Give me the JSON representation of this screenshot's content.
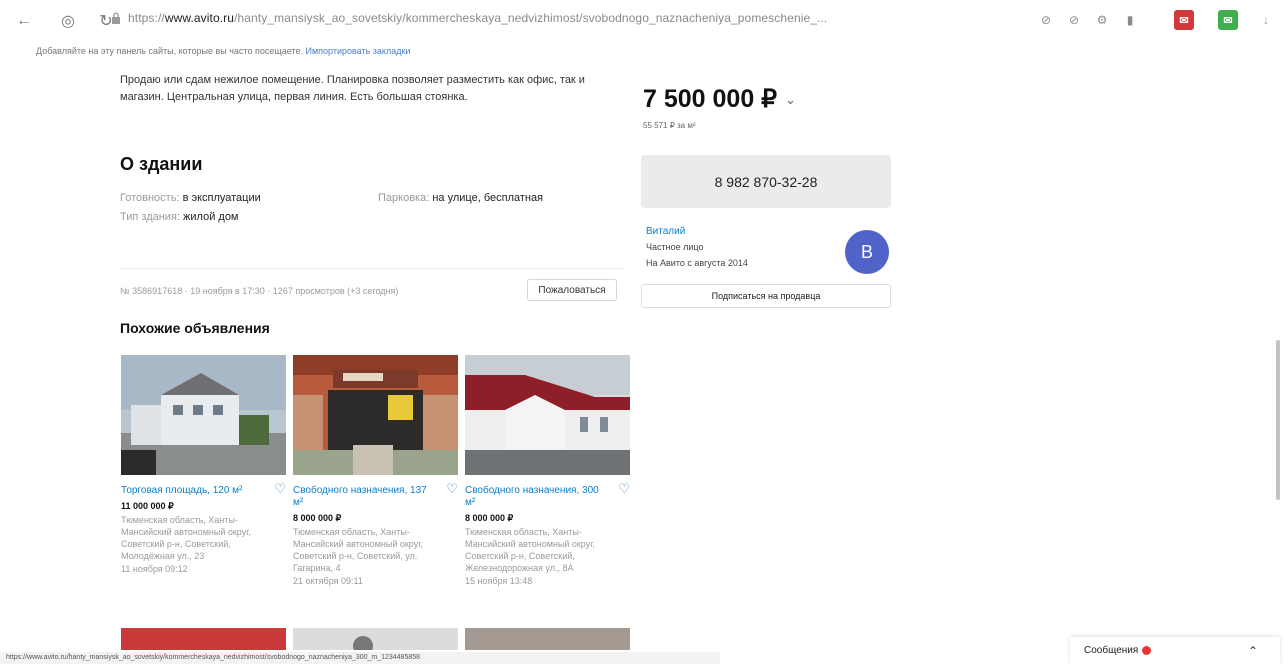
{
  "browser": {
    "url_prefix": "https://",
    "url_domain": "www.avito.ru",
    "url_rest": "/hanty_mansiysk_ao_sovetskiy/kommercheskaya_nedvizhimost/svobodnogo_naznacheniya_pomeschenie_...",
    "bookmarks_hint": "Добавляйте на эту панель сайты, которые вы часто посещаете.",
    "bookmarks_import": "Импортировать закладки"
  },
  "listing": {
    "description": "Продаю или сдам нежилое помещение. Планировка позволяет разместить как офис, так и магазин. Центральная улица, первая линия. Есть большая стоянка.",
    "building_heading": "О здании",
    "props": [
      {
        "key": "Готовность:",
        "value": "в эксплуатации"
      },
      {
        "key": "Тип здания:",
        "value": "жилой дом"
      },
      {
        "key": "Парковка:",
        "value": "на улице, бесплатная"
      }
    ],
    "meta": "№ 3586917618 · 19 ноября в 17:30 · 1267 просмотров (+3 сегодня)",
    "complain_label": "Пожаловаться",
    "price": "7 500 000 ₽",
    "price_per_m2": "55 571 ₽ за м²",
    "phone": "8 982 870-32-28",
    "seller_name": "Виталий",
    "seller_type": "Частное лицо",
    "seller_since": "На Авито с августа 2014",
    "avatar_letter": "В",
    "subscribe_label": "Подписаться на продавца"
  },
  "similar": {
    "heading": "Похожие объявления",
    "items": [
      {
        "title": "Торговая площадь, 120 м²",
        "price": "11 000 000 ₽",
        "address": "Тюменская область, Ханты-Мансийский автономный округ, Советский р-н, Советский, Молодёжная ул., 23",
        "date": "11 ноября 09:12"
      },
      {
        "title": "Свободного назначения, 137 м²",
        "price": "8 000 000 ₽",
        "address": "Тюменская область, Ханты-Мансийский автономный округ, Советский р-н, Советский, ул. Гагарина, 4",
        "date": "21 октября 09:11"
      },
      {
        "title": "Свободного назначения, 300 м²",
        "price": "8 000 000 ₽",
        "address": "Тюменская область, Ханты-Мансийский автономный округ, Советский р-н, Советский, Железнодорожная ул., 8А",
        "date": "15 ноября 13:48"
      }
    ]
  },
  "statusbar": {
    "url": "https://www.avito.ru/hanty_mansiysk_ao_sovetskiy/kommercheskaya_nedvizhimost/svobodnogo_naznacheniya_300_m_1234485858"
  },
  "messenger": {
    "label": "Сообщения"
  }
}
